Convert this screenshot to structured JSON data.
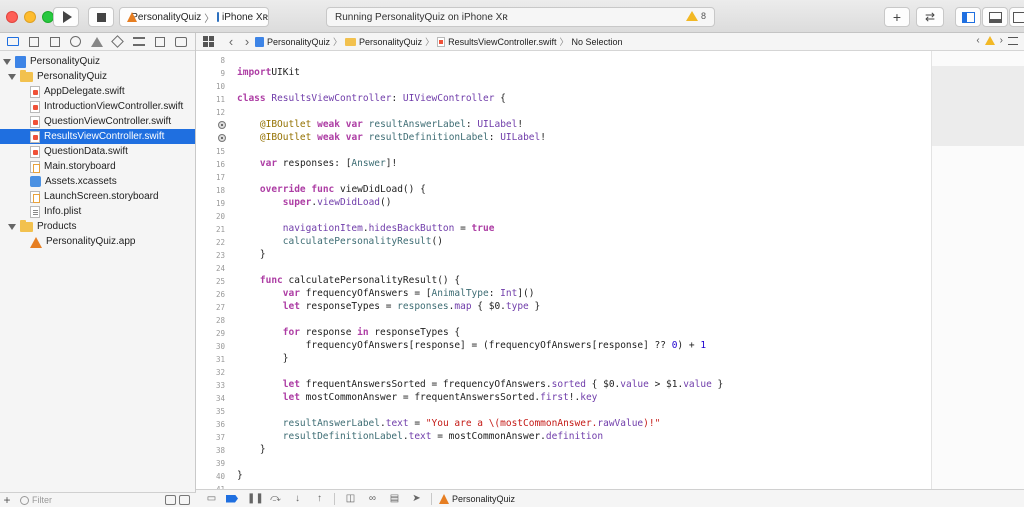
{
  "toolbar": {
    "scheme_app": "PersonalityQuiz",
    "scheme_device": "iPhone Xʀ",
    "activity_text": "Running PersonalityQuiz on iPhone Xʀ",
    "warning_count": "8",
    "plus_label": "+",
    "swap_label": "⇄"
  },
  "navigator": {
    "items": [
      {
        "label": "PersonalityQuiz",
        "kind": "project"
      },
      {
        "label": "PersonalityQuiz",
        "kind": "folder"
      },
      {
        "label": "AppDelegate.swift",
        "kind": "swift"
      },
      {
        "label": "IntroductionViewController.swift",
        "kind": "swift"
      },
      {
        "label": "QuestionViewController.swift",
        "kind": "swift"
      },
      {
        "label": "ResultsViewController.swift",
        "kind": "swift",
        "selected": true
      },
      {
        "label": "QuestionData.swift",
        "kind": "swift"
      },
      {
        "label": "Main.storyboard",
        "kind": "storyboard"
      },
      {
        "label": "Assets.xcassets",
        "kind": "assets"
      },
      {
        "label": "LaunchScreen.storyboard",
        "kind": "storyboard"
      },
      {
        "label": "Info.plist",
        "kind": "plist"
      },
      {
        "label": "Products",
        "kind": "folder"
      },
      {
        "label": "PersonalityQuiz.app",
        "kind": "app"
      }
    ],
    "filter_placeholder": "Filter",
    "add_label": "+"
  },
  "jumpbar": {
    "crumb_project": "PersonalityQuiz",
    "crumb_group": "PersonalityQuiz",
    "crumb_file": "ResultsViewController.swift",
    "crumb_symbol": "No Selection"
  },
  "editor": {
    "lines": [
      {
        "n": "8",
        "code": []
      },
      {
        "n": "9",
        "code": [
          [
            "kw",
            "import"
          ],
          [
            "",
            "UIKit"
          ]
        ]
      },
      {
        "n": "10",
        "code": []
      },
      {
        "n": "11",
        "code": [
          [
            "kw",
            "class"
          ],
          [
            "",
            " "
          ],
          [
            "ty",
            "ResultsViewController"
          ],
          [
            "",
            ": "
          ],
          [
            "ty",
            "UIViewController"
          ],
          [
            "",
            " {"
          ]
        ]
      },
      {
        "n": "12",
        "code": []
      },
      {
        "n": "",
        "bp": true,
        "code": [
          [
            "",
            "    "
          ],
          [
            "attr",
            "@IBOutlet"
          ],
          [
            "",
            " "
          ],
          [
            "kw",
            "weak"
          ],
          [
            "",
            " "
          ],
          [
            "kw",
            "var"
          ],
          [
            "",
            " "
          ],
          [
            "fn",
            "resultAnswerLabel"
          ],
          [
            "",
            ": "
          ],
          [
            "ty",
            "UILabel"
          ],
          [
            "",
            "!"
          ]
        ]
      },
      {
        "n": "",
        "bp": true,
        "code": [
          [
            "",
            "    "
          ],
          [
            "attr",
            "@IBOutlet"
          ],
          [
            "",
            " "
          ],
          [
            "kw",
            "weak"
          ],
          [
            "",
            " "
          ],
          [
            "kw",
            "var"
          ],
          [
            "",
            " "
          ],
          [
            "fn",
            "resultDefinitionLabel"
          ],
          [
            "",
            ": "
          ],
          [
            "ty",
            "UILabel"
          ],
          [
            "",
            "!"
          ]
        ]
      },
      {
        "n": "15",
        "code": []
      },
      {
        "n": "16",
        "code": [
          [
            "",
            "    "
          ],
          [
            "kw",
            "var"
          ],
          [
            "",
            " responses: ["
          ],
          [
            "fn",
            "Answer"
          ],
          [
            "",
            "]!"
          ]
        ]
      },
      {
        "n": "17",
        "code": []
      },
      {
        "n": "18",
        "code": [
          [
            "",
            "    "
          ],
          [
            "kw",
            "override"
          ],
          [
            "",
            " "
          ],
          [
            "kw",
            "func"
          ],
          [
            "",
            " viewDidLoad() {"
          ]
        ]
      },
      {
        "n": "19",
        "code": [
          [
            "",
            "        "
          ],
          [
            "kw",
            "super"
          ],
          [
            "",
            "."
          ],
          [
            "ty",
            "viewDidLoad"
          ],
          [
            "",
            "()"
          ]
        ]
      },
      {
        "n": "20",
        "code": []
      },
      {
        "n": "21",
        "code": [
          [
            "",
            "        "
          ],
          [
            "ty",
            "navigationItem"
          ],
          [
            "",
            "."
          ],
          [
            "ty",
            "hidesBackButton"
          ],
          [
            "",
            " = "
          ],
          [
            "kw",
            "true"
          ]
        ]
      },
      {
        "n": "22",
        "code": [
          [
            "",
            "        "
          ],
          [
            "fn",
            "calculatePersonalityResult"
          ],
          [
            "",
            "()"
          ]
        ]
      },
      {
        "n": "23",
        "code": [
          [
            "",
            "    }"
          ]
        ]
      },
      {
        "n": "24",
        "code": []
      },
      {
        "n": "25",
        "code": [
          [
            "",
            "    "
          ],
          [
            "kw",
            "func"
          ],
          [
            "",
            " calculatePersonalityResult() {"
          ]
        ]
      },
      {
        "n": "26",
        "code": [
          [
            "",
            "        "
          ],
          [
            "kw",
            "var"
          ],
          [
            "",
            " frequencyOfAnswers = ["
          ],
          [
            "fn",
            "AnimalType"
          ],
          [
            "",
            ": "
          ],
          [
            "ty",
            "Int"
          ],
          [
            "",
            "]()"
          ]
        ]
      },
      {
        "n": "27",
        "code": [
          [
            "",
            "        "
          ],
          [
            "kw",
            "let"
          ],
          [
            "",
            " responseTypes = "
          ],
          [
            "fn",
            "responses"
          ],
          [
            "",
            "."
          ],
          [
            "ty",
            "map"
          ],
          [
            "",
            " { $0."
          ],
          [
            "ty",
            "type"
          ],
          [
            "",
            " }"
          ]
        ]
      },
      {
        "n": "28",
        "code": []
      },
      {
        "n": "29",
        "code": [
          [
            "",
            "        "
          ],
          [
            "kw",
            "for"
          ],
          [
            "",
            " response "
          ],
          [
            "kw",
            "in"
          ],
          [
            "",
            " responseTypes {"
          ]
        ]
      },
      {
        "n": "30",
        "code": [
          [
            "",
            "            frequencyOfAnswers[response] = (frequencyOfAnswers[response] ?? "
          ],
          [
            "num",
            "0"
          ],
          [
            "",
            ") + "
          ],
          [
            "num",
            "1"
          ]
        ]
      },
      {
        "n": "31",
        "code": [
          [
            "",
            "        }"
          ]
        ]
      },
      {
        "n": "32",
        "code": []
      },
      {
        "n": "33",
        "code": [
          [
            "",
            "        "
          ],
          [
            "kw",
            "let"
          ],
          [
            "",
            " frequentAnswersSorted = frequencyOfAnswers."
          ],
          [
            "ty",
            "sorted"
          ],
          [
            "",
            " { $0."
          ],
          [
            "ty",
            "value"
          ],
          [
            "",
            " > $1."
          ],
          [
            "ty",
            "value"
          ],
          [
            "",
            " }"
          ]
        ]
      },
      {
        "n": "34",
        "code": [
          [
            "",
            "        "
          ],
          [
            "kw",
            "let"
          ],
          [
            "",
            " mostCommonAnswer = frequentAnswersSorted."
          ],
          [
            "ty",
            "first"
          ],
          [
            "",
            "!."
          ],
          [
            "ty",
            "key"
          ]
        ]
      },
      {
        "n": "35",
        "code": []
      },
      {
        "n": "36",
        "code": [
          [
            "",
            "        "
          ],
          [
            "fn",
            "resultAnswerLabel"
          ],
          [
            "",
            "."
          ],
          [
            "ty",
            "text"
          ],
          [
            "",
            " = "
          ],
          [
            "str",
            "\"You are a \\(mostCommonAnswer."
          ],
          [
            "ty",
            "rawValue"
          ],
          [
            "str",
            ")!\""
          ]
        ]
      },
      {
        "n": "37",
        "code": [
          [
            "",
            "        "
          ],
          [
            "fn",
            "resultDefinitionLabel"
          ],
          [
            "",
            "."
          ],
          [
            "ty",
            "text"
          ],
          [
            "",
            " = mostCommonAnswer."
          ],
          [
            "ty",
            "definition"
          ]
        ]
      },
      {
        "n": "38",
        "code": [
          [
            "",
            "    }"
          ]
        ]
      },
      {
        "n": "39",
        "code": []
      },
      {
        "n": "40",
        "code": [
          [
            "",
            "}"
          ]
        ]
      },
      {
        "n": "41",
        "code": []
      }
    ]
  },
  "debugbar": {
    "target": "PersonalityQuiz"
  },
  "colors": {
    "selection": "#1f6fe0",
    "keyword": "#ad3da4",
    "type": "#703daa",
    "string": "#c41a16",
    "number": "#1c00cf"
  }
}
